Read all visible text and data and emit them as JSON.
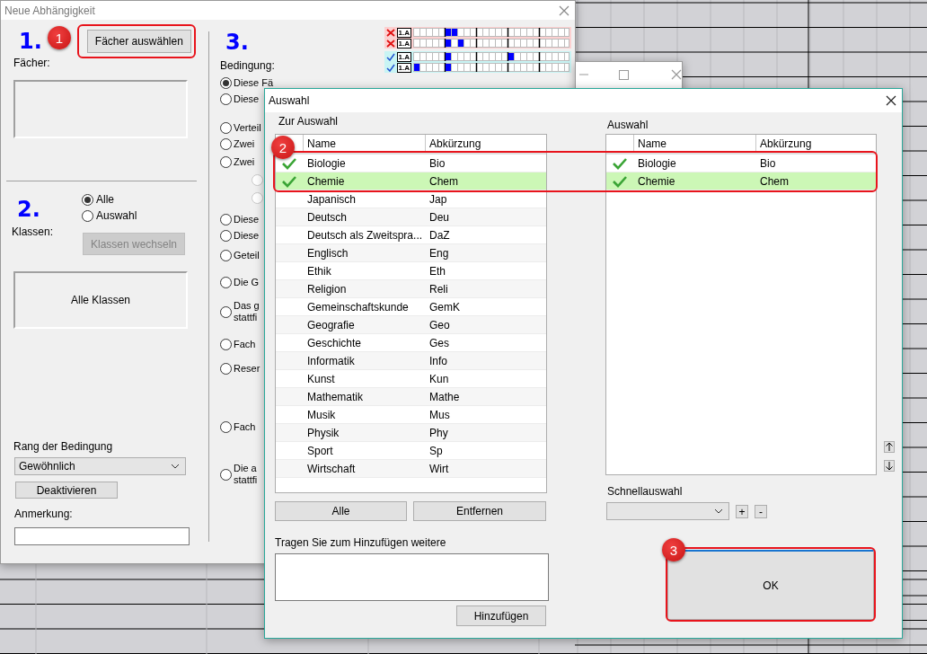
{
  "main_window": {
    "title": "Neue Abhängigkeit",
    "step_1": {
      "marker": "1.",
      "button": "Fächer auswählen",
      "label": "Fächer:"
    },
    "step_2": {
      "marker": "2.",
      "label": "Klassen:",
      "options": [
        {
          "label": "Alle",
          "selected": true
        },
        {
          "label": "Auswahl",
          "selected": false
        }
      ],
      "button": {
        "label": "Klassen wechseln",
        "disabled": true
      },
      "classes_box": "Alle Klassen"
    },
    "rank": {
      "label": "Rang der Bedingung",
      "value": "Gewöhnlich"
    },
    "deactivate_button": "Deaktivieren",
    "note": {
      "label": "Anmerkung:"
    },
    "step_3": {
      "marker": "3.",
      "label": "Bedingung:",
      "options": [
        {
          "kind": "radio",
          "lines": [
            "Diese Fä"
          ],
          "selected": true,
          "disabled": false
        },
        {
          "kind": "radio",
          "lines": [
            "Diese"
          ],
          "selected": false,
          "disabled": false
        },
        {
          "kind": "radio",
          "lines": [
            "Verteil"
          ],
          "selected": false,
          "disabled": false
        },
        {
          "kind": "radio",
          "lines": [
            "Zwei"
          ],
          "selected": false,
          "disabled": false
        },
        {
          "kind": "radio",
          "lines": [
            "Zwei"
          ],
          "selected": false,
          "disabled": false
        },
        {
          "kind": "sub",
          "selected": false,
          "disabled": true
        },
        {
          "kind": "sub",
          "selected": false,
          "disabled": true
        },
        {
          "kind": "radio",
          "lines": [
            "Diese"
          ],
          "selected": false,
          "disabled": false
        },
        {
          "kind": "radio",
          "lines": [
            "Diese"
          ],
          "selected": false,
          "disabled": false
        },
        {
          "kind": "radio",
          "lines": [
            "Geteil"
          ],
          "selected": false,
          "disabled": false
        },
        {
          "kind": "radio",
          "lines": [
            "Die G"
          ],
          "selected": false,
          "disabled": false
        },
        {
          "kind": "radio",
          "lines": [
            "Das g",
            "stattfi"
          ],
          "selected": false,
          "disabled": false
        },
        {
          "kind": "radio",
          "lines": [
            "Fach"
          ],
          "selected": false,
          "disabled": false
        },
        {
          "kind": "radio",
          "lines": [
            "Reser"
          ],
          "selected": false,
          "disabled": false
        },
        {
          "kind": "radio",
          "lines": [
            "Fach"
          ],
          "selected": false,
          "disabled": false
        },
        {
          "kind": "radio",
          "lines": [
            "Die a",
            "stattfi"
          ],
          "selected": false,
          "disabled": false
        }
      ]
    },
    "rules_preview": [
      {
        "valid": false,
        "class_label": "1.A"
      },
      {
        "valid": false,
        "class_label": "1.A"
      },
      {
        "valid": true,
        "class_label": "1.A"
      },
      {
        "valid": true,
        "class_label": "1.A"
      }
    ]
  },
  "dialog": {
    "title": "Auswahl",
    "available": {
      "label": "Zur Auswahl",
      "columns": [
        "Name",
        "Abkürzung"
      ],
      "rows": [
        {
          "name": "Biologie",
          "short": "Bio",
          "checked": true,
          "selected": false
        },
        {
          "name": "Chemie",
          "short": "Chem",
          "checked": true,
          "selected": true
        },
        {
          "name": "Japanisch",
          "short": "Jap",
          "checked": false,
          "selected": false
        },
        {
          "name": "Deutsch",
          "short": "Deu",
          "checked": false,
          "selected": false
        },
        {
          "name": "Deutsch als Zweitspra...",
          "short": "DaZ",
          "checked": false,
          "selected": false
        },
        {
          "name": "Englisch",
          "short": "Eng",
          "checked": false,
          "selected": false
        },
        {
          "name": "Ethik",
          "short": "Eth",
          "checked": false,
          "selected": false
        },
        {
          "name": "Religion",
          "short": "Reli",
          "checked": false,
          "selected": false
        },
        {
          "name": "Gemeinschaftskunde",
          "short": "GemK",
          "checked": false,
          "selected": false
        },
        {
          "name": "Geografie",
          "short": "Geo",
          "checked": false,
          "selected": false
        },
        {
          "name": "Geschichte",
          "short": "Ges",
          "checked": false,
          "selected": false
        },
        {
          "name": "Informatik",
          "short": "Info",
          "checked": false,
          "selected": false
        },
        {
          "name": "Kunst",
          "short": "Kun",
          "checked": false,
          "selected": false
        },
        {
          "name": "Mathematik",
          "short": "Mathe",
          "checked": false,
          "selected": false
        },
        {
          "name": "Musik",
          "short": "Mus",
          "checked": false,
          "selected": false
        },
        {
          "name": "Physik",
          "short": "Phy",
          "checked": false,
          "selected": false
        },
        {
          "name": "Sport",
          "short": "Sp",
          "checked": false,
          "selected": false
        },
        {
          "name": "Wirtschaft",
          "short": "Wirt",
          "checked": false,
          "selected": false
        }
      ]
    },
    "chosen": {
      "label": "Auswahl",
      "columns": [
        "Name",
        "Abkürzung"
      ],
      "rows": [
        {
          "name": "Biologie",
          "short": "Bio",
          "checked": true,
          "selected": false
        },
        {
          "name": "Chemie",
          "short": "Chem",
          "checked": true,
          "selected": true
        }
      ]
    },
    "all_button": "Alle",
    "remove_button": "Entfernen",
    "add_hint": "Tragen Sie zum Hinzufügen weitere",
    "add_button": "Hinzufügen",
    "quick_select": {
      "label": "Schnellauswahl",
      "plus": "+",
      "minus": "-"
    },
    "ok_button": "OK"
  },
  "annotations": [
    {
      "label": "1"
    },
    {
      "label": "2"
    },
    {
      "label": "3"
    }
  ]
}
